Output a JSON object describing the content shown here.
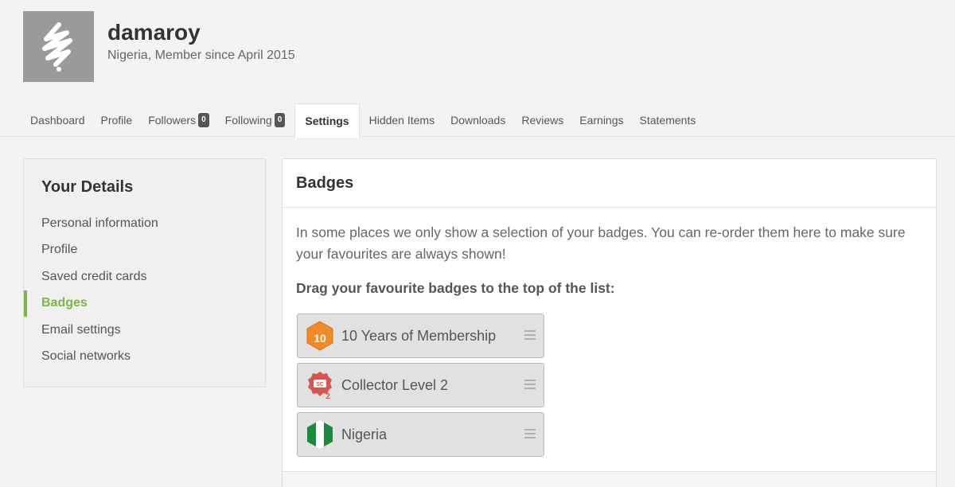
{
  "profile": {
    "username": "damaroy",
    "subtitle": "Nigeria, Member since April 2015",
    "avatar_icon": "scribble-logo-icon"
  },
  "tabs": [
    {
      "label": "Dashboard"
    },
    {
      "label": "Profile"
    },
    {
      "label": "Followers",
      "count": "0"
    },
    {
      "label": "Following",
      "count": "0"
    },
    {
      "label": "Settings",
      "active": true
    },
    {
      "label": "Hidden Items"
    },
    {
      "label": "Downloads"
    },
    {
      "label": "Reviews"
    },
    {
      "label": "Earnings"
    },
    {
      "label": "Statements"
    }
  ],
  "sidebar": {
    "title": "Your Details",
    "items": [
      {
        "label": "Personal information"
      },
      {
        "label": "Profile"
      },
      {
        "label": "Saved credit cards"
      },
      {
        "label": "Badges",
        "active": true
      },
      {
        "label": "Email settings"
      },
      {
        "label": "Social networks"
      }
    ]
  },
  "panel": {
    "title": "Badges",
    "description": "In some places we only show a selection of your badges. You can re-order them here to make sure your favourites are always shown!",
    "prompt": "Drag your favourite badges to the top of the list:",
    "badges": [
      {
        "label": "10 Years of Membership",
        "icon": "ten-years-hexagon-icon",
        "icon_text": "10"
      },
      {
        "label": "Collector Level 2",
        "icon": "collector-seal-icon",
        "icon_text": "SC",
        "icon_sub": "2"
      },
      {
        "label": "Nigeria",
        "icon": "nigeria-flag-icon"
      }
    ]
  },
  "colors": {
    "accent_green": "#7db643",
    "badge_orange": "#f08a24",
    "badge_red": "#d9534f",
    "flag_green": "#1c8a3c"
  }
}
